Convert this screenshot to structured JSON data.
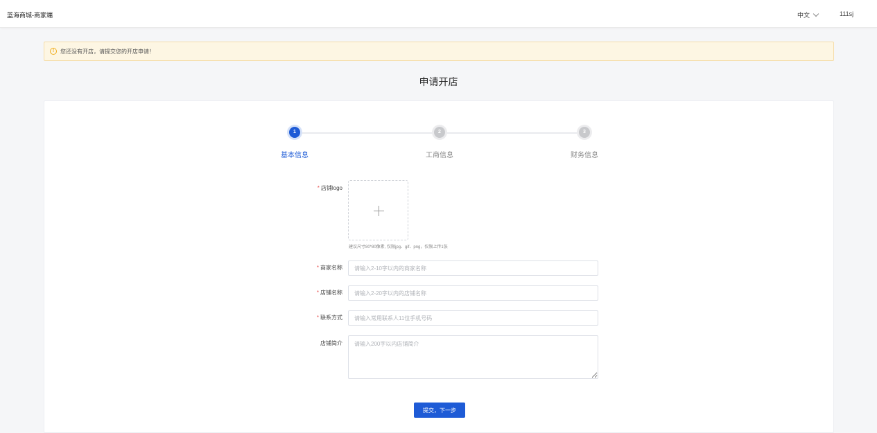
{
  "header": {
    "brand": "蓝海商城-商家端",
    "language": "中文",
    "username": "111sj"
  },
  "alert": {
    "icon": "warning-circle-icon",
    "message": "您还没有开店，请提交您的开店申请！"
  },
  "page_title": "申请开店",
  "steps": [
    {
      "number": "1",
      "label": "基本信息",
      "active": true
    },
    {
      "number": "2",
      "label": "工商信息",
      "active": false
    },
    {
      "number": "3",
      "label": "财务信息",
      "active": false
    }
  ],
  "form": {
    "logo_label": "店铺logo",
    "logo_hint": "建议尺寸80*80像素, 仅限jpg、gif、png，仅限上传1张",
    "merchant_name_label": "商家名称",
    "merchant_name_placeholder": "请输入2-10字以内的商家名称",
    "shop_name_label": "店铺名称",
    "shop_name_placeholder": "请输入2-20字以内的店铺名称",
    "contact_label": "联系方式",
    "contact_placeholder": "请输入常用联系人11位手机号码",
    "intro_label": "店铺简介",
    "intro_placeholder": "请输入200字以内店铺简介",
    "submit_label": "提交，下一步"
  },
  "colors": {
    "primary": "#1e5bd6",
    "alert_bg": "#fdf6e3",
    "warning": "#f0ad1e",
    "required": "#e85454"
  }
}
